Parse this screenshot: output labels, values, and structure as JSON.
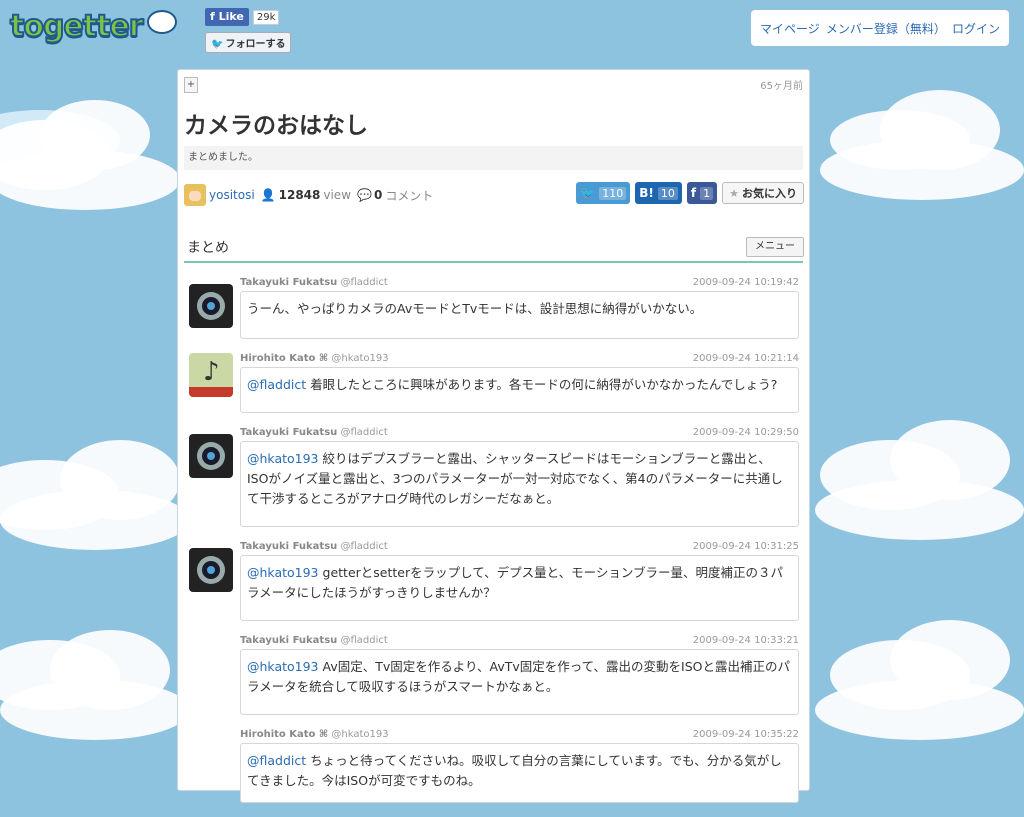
{
  "header": {
    "logo": "togetter",
    "fb_like_label": "Like",
    "fb_like_count": "29k",
    "twitter_follow_label": "フォローする",
    "nav": [
      "マイページ",
      "メンバー登録（無料）",
      "ログイン"
    ]
  },
  "article": {
    "plus_label": "+",
    "age": "65ヶ月前",
    "title": "カメラのおはなし",
    "description": "まとめました。",
    "author": "yositosi",
    "views": "12848",
    "view_label": "view",
    "comments": "0",
    "comment_label": "コメント",
    "shares": {
      "twitter": "110",
      "hatena_label": "B!",
      "hatena": "10",
      "facebook_label": "f",
      "facebook": "1",
      "favorite_label": "お気に入り"
    },
    "section_title": "まとめ",
    "menu_label": "メニュー"
  },
  "tweets": [
    {
      "name": "Takayuki Fukatsu",
      "handle": "@fladdict",
      "time": "2009-09-24 10:19:42",
      "mention": "",
      "text": "うーん、やっぱりカメラのAvモードとTvモードは、設計思想に納得がいかない。",
      "avatar": "camera-lens-avatar"
    },
    {
      "name": "Hirohito Kato ⌘",
      "handle": "@hkato193",
      "time": "2009-09-24 10:21:14",
      "mention": "@fladdict",
      "text": "着眼したところに興味があります。各モードの何に納得がいかなかったんでしょう?",
      "avatar": "music-note-avatar"
    },
    {
      "name": "Takayuki Fukatsu",
      "handle": "@fladdict",
      "time": "2009-09-24 10:29:50",
      "mention": "@hkato193",
      "text": "絞りはデプスブラーと露出、シャッタースピードはモーションブラーと露出と、ISOがノイズ量と露出と、3つのパラメーターが一対一対応でなく、第4のパラメーターに共通して干渉するところがアナログ時代のレガシーだなぁと。",
      "avatar": "camera-lens-avatar"
    },
    {
      "name": "Takayuki Fukatsu",
      "handle": "@fladdict",
      "time": "2009-09-24 10:31:25",
      "mention": "@hkato193",
      "text": "getterとsetterをラップして、デプス量と、モーションブラー量、明度補正の３パラメータにしたほうがすっきりしませんか？",
      "avatar": "camera-lens-avatar"
    },
    {
      "name": "Takayuki Fukatsu",
      "handle": "@fladdict",
      "time": "2009-09-24 10:33:21",
      "mention": "@hkato193",
      "text": "Av固定、Tv固定を作るより、AvTv固定を作って、露出の変動をISOと露出補正のパラメータを統合して吸収するほうがスマートかなぁと。",
      "avatar": ""
    },
    {
      "name": "Hirohito Kato ⌘",
      "handle": "@hkato193",
      "time": "2009-09-24 10:35:22",
      "mention": "@fladdict",
      "text": "ちょっと待ってくださいね。吸収して自分の言葉にしています。でも、分かる気がしてきました。今はISOが可変ですものね。",
      "avatar": ""
    }
  ]
}
